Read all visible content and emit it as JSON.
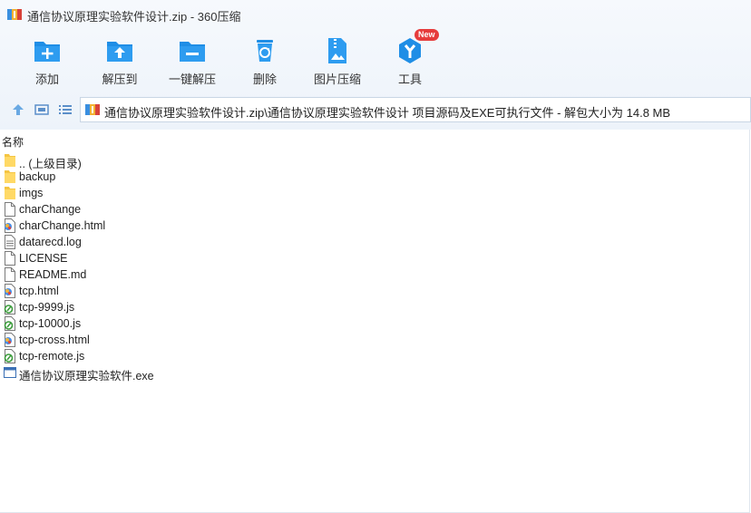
{
  "window": {
    "title": "通信协议原理实验软件设计.zip - 360压缩"
  },
  "toolbar": {
    "items": [
      {
        "label": "添加",
        "icon": "add-folder-icon"
      },
      {
        "label": "解压到",
        "icon": "extract-to-icon"
      },
      {
        "label": "一键解压",
        "icon": "one-click-extract-icon"
      },
      {
        "label": "删除",
        "icon": "recycle-bin-icon"
      },
      {
        "label": "图片压缩",
        "icon": "image-compress-icon"
      },
      {
        "label": "工具",
        "icon": "tools-icon",
        "badge": "New"
      }
    ]
  },
  "address": {
    "path": "通信协议原理实验软件设计.zip\\通信协议原理实验软件设计 项目源码及EXE可执行文件 - 解包大小为 14.8 MB"
  },
  "list": {
    "column_name": "名称",
    "files": [
      {
        "name": ".. (上级目录)",
        "type": "folder"
      },
      {
        "name": "backup",
        "type": "folder"
      },
      {
        "name": "imgs",
        "type": "folder"
      },
      {
        "name": "charChange",
        "type": "file"
      },
      {
        "name": "charChange.html",
        "type": "html"
      },
      {
        "name": "datarecd.log",
        "type": "text"
      },
      {
        "name": "LICENSE",
        "type": "file"
      },
      {
        "name": "README.md",
        "type": "file"
      },
      {
        "name": "tcp.html",
        "type": "html"
      },
      {
        "name": "tcp-9999.js",
        "type": "js"
      },
      {
        "name": "tcp-10000.js",
        "type": "js"
      },
      {
        "name": "tcp-cross.html",
        "type": "html"
      },
      {
        "name": "tcp-remote.js",
        "type": "js"
      },
      {
        "name": "通信协议原理实验软件.exe",
        "type": "exe"
      }
    ]
  },
  "colors": {
    "accent": "#1f8ee6",
    "toolbar_bg": "#edf3fa",
    "badge": "#e63c3c",
    "folder": "#f5c542"
  }
}
